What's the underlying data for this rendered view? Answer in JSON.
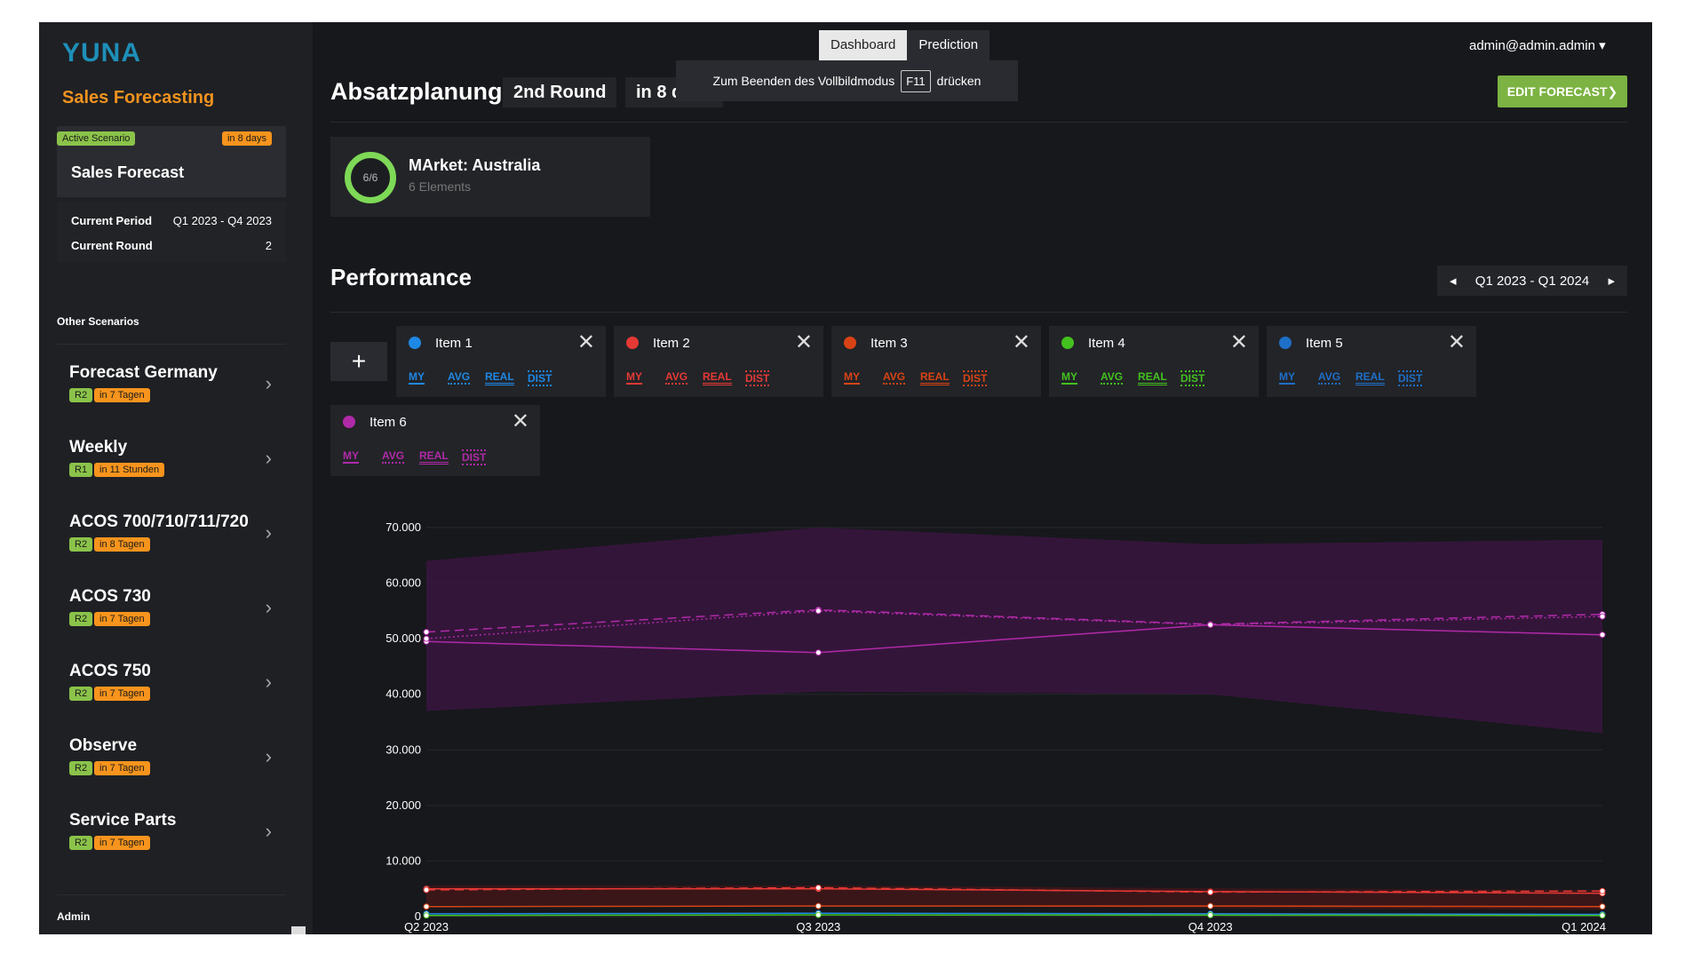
{
  "app": {
    "brand": "YUNA",
    "subtitle": "Sales Forecasting"
  },
  "active_scenario": {
    "badge": "Active Scenario",
    "due": "in 8 days",
    "title": "Sales Forecast",
    "period_label": "Current Period",
    "period_value": "Q1 2023 - Q4 2023",
    "round_label": "Current Round",
    "round_value": "2"
  },
  "other_label": "Other Scenarios",
  "scenarios": [
    {
      "name": "Forecast Germany",
      "round": "R2",
      "due": "in 7 Tagen"
    },
    {
      "name": "Weekly",
      "round": "R1",
      "due": "in 11 Stunden"
    },
    {
      "name": "ACOS 700/710/711/720",
      "round": "R2",
      "due": "in 8 Tagen"
    },
    {
      "name": "ACOS 730",
      "round": "R2",
      "due": "in 7 Tagen"
    },
    {
      "name": "ACOS 750",
      "round": "R2",
      "due": "in 7 Tagen"
    },
    {
      "name": "Observe",
      "round": "R2",
      "due": "in 7 Tagen"
    },
    {
      "name": "Service Parts",
      "round": "R2",
      "due": "in 7 Tagen"
    }
  ],
  "admin_label": "Admin",
  "tabs": [
    "Dashboard",
    "Prediction"
  ],
  "toast": {
    "pre": "Zum Beenden des Vollbildmodus",
    "key": "F11",
    "post": "drücken"
  },
  "user": "admin@admin.admin ▾",
  "header": {
    "title": "Absatzplanung",
    "round": "2nd Round",
    "due": "in 8 days",
    "edit": "EDIT FORECAST❯"
  },
  "market": {
    "progress": "6/6",
    "title": "MArket: Australia",
    "subtitle": "6 Elements"
  },
  "performance": {
    "title": "Performance",
    "range": "Q1 2023 - Q1 2024",
    "prev": "◂",
    "next": "▸"
  },
  "add_label": "+",
  "toggle_labels": [
    "MY",
    "AVG",
    "REAL",
    "DIST"
  ],
  "items": [
    {
      "name": "Item 1",
      "color": "#1e88e5"
    },
    {
      "name": "Item 2",
      "color": "#e53935"
    },
    {
      "name": "Item 3",
      "color": "#d84315"
    },
    {
      "name": "Item 4",
      "color": "#43c11f"
    },
    {
      "name": "Item 5",
      "color": "#1e6fc8"
    },
    {
      "name": "Item 6",
      "color": "#b02aa8"
    }
  ],
  "chart_data": {
    "type": "line",
    "x": [
      "Q2 2023",
      "Q3 2023",
      "Q4 2023",
      "Q1 2024"
    ],
    "ylim": [
      0,
      70000
    ],
    "yticks": [
      "0",
      "10.000",
      "20.000",
      "30.000",
      "40.000",
      "50.000",
      "60.000",
      "70.000"
    ],
    "series": [
      {
        "item": "Item 6",
        "kind": "MY",
        "values": [
          49500,
          47500,
          52500,
          50700
        ]
      },
      {
        "item": "Item 6",
        "kind": "AVG",
        "values": [
          51200,
          55200,
          52600,
          54400
        ]
      },
      {
        "item": "Item 6",
        "kind": "REAL",
        "values": [
          50000,
          55000,
          52500,
          54000
        ]
      },
      {
        "item": "Item 6",
        "kind": "DIST_HIGH",
        "values": [
          64000,
          70000,
          67000,
          67800
        ]
      },
      {
        "item": "Item 6",
        "kind": "DIST_LOW",
        "values": [
          37000,
          40500,
          40000,
          33000
        ]
      },
      {
        "item": "Item 2",
        "kind": "MY",
        "values": [
          5000,
          5000,
          4500,
          4200
        ]
      },
      {
        "item": "Item 2",
        "kind": "AVG",
        "values": [
          4800,
          5200,
          4400,
          4600
        ]
      },
      {
        "item": "Item 3",
        "kind": "MY",
        "values": [
          1800,
          1900,
          1900,
          1800
        ]
      },
      {
        "item": "Item 1",
        "kind": "MY",
        "values": [
          500,
          600,
          500,
          400
        ]
      },
      {
        "item": "Item 4",
        "kind": "MY",
        "values": [
          200,
          300,
          250,
          200
        ]
      }
    ]
  }
}
